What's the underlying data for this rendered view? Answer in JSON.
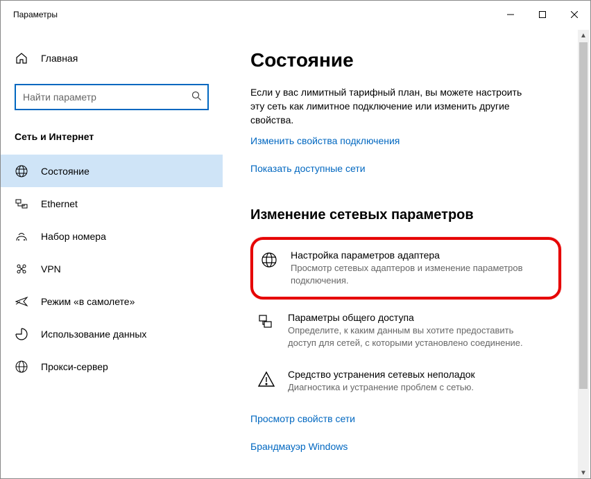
{
  "window": {
    "title": "Параметры"
  },
  "sidebar": {
    "home": "Главная",
    "search_placeholder": "Найти параметр",
    "section": "Сеть и Интернет",
    "items": [
      {
        "label": "Состояние",
        "selected": true
      },
      {
        "label": "Ethernet"
      },
      {
        "label": "Набор номера"
      },
      {
        "label": "VPN"
      },
      {
        "label": "Режим «в самолете»"
      },
      {
        "label": "Использование данных"
      },
      {
        "label": "Прокси-сервер"
      }
    ]
  },
  "main": {
    "title": "Состояние",
    "description": "Если у вас лимитный тарифный план, вы можете настроить эту сеть как лимитное подключение или изменить другие свойства.",
    "link_props": "Изменить свойства подключения",
    "link_show": "Показать доступные сети",
    "subhead": "Изменение сетевых параметров",
    "actions": [
      {
        "title": "Настройка параметров адаптера",
        "desc": "Просмотр сетевых адаптеров и изменение параметров подключения.",
        "highlight": true
      },
      {
        "title": "Параметры общего доступа",
        "desc": "Определите, к каким данным вы хотите предоставить доступ для сетей, с которыми установлено соединение."
      },
      {
        "title": "Средство устранения сетевых неполадок",
        "desc": "Диагностика и устранение проблем с сетью."
      }
    ],
    "link_view_props": "Просмотр свойств сети",
    "link_firewall": "Брандмауэр Windows"
  }
}
